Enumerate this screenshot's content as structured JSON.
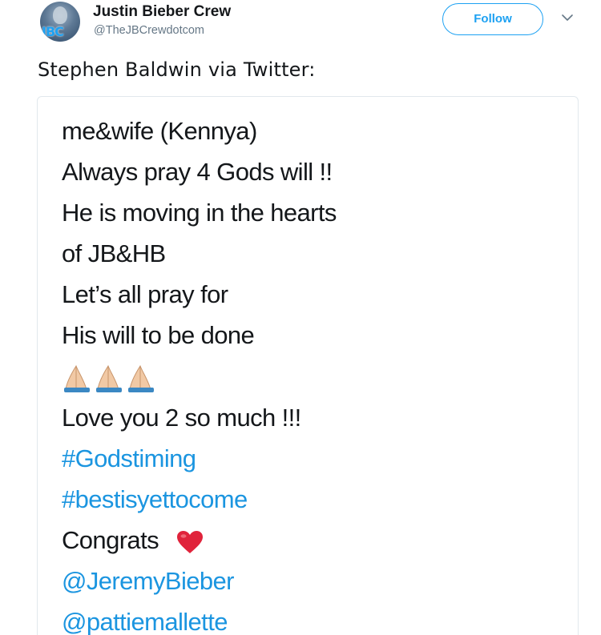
{
  "header": {
    "display_name": "Justin Bieber Crew",
    "handle": "@TheJBCrewdotcom",
    "avatar_logo": "JBC",
    "follow_label": "Follow",
    "chevron_icon": "chevron-down-icon"
  },
  "tweet": {
    "text": "Stephen Baldwin via Twitter:"
  },
  "image": {
    "lines": [
      "me&wife (Kennya)",
      "Always pray 4 Gods will  !!",
      "He is moving in the hearts",
      "of JB&HB",
      "Let’s all pray for",
      "His will to be done"
    ],
    "emoji": "folded-hands-icon",
    "love_line": "Love you 2 so much !!!",
    "hashtags": [
      "#Godstiming",
      "#bestisyettocome"
    ],
    "congrats": "Congrats",
    "heart_icon": "red-heart-icon",
    "mentions": [
      "@JeremyBieber",
      "@pattiemallette"
    ]
  },
  "colors": {
    "link": "#1b95e0",
    "follow": "#1da1f2",
    "secondary_text": "#657786",
    "heart": "#e0233b"
  }
}
